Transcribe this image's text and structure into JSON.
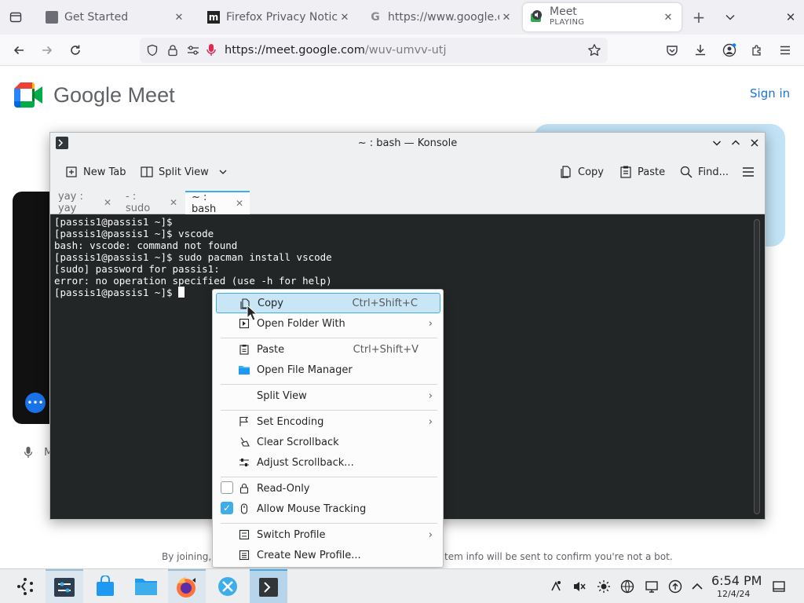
{
  "browser": {
    "tabs": [
      {
        "title": "Get Started"
      },
      {
        "title": "Firefox Privacy Notice"
      },
      {
        "title": "https://www.google.c"
      },
      {
        "title": "Meet",
        "subtitle": "PLAYING"
      }
    ],
    "url": {
      "host": "https://meet.google.com",
      "path": "/wuv-umvv-utj"
    }
  },
  "page": {
    "logo_text": "Google Meet",
    "sign_in": "Sign in",
    "mic_label": "M",
    "footer_left": "By joining, y",
    "footer_right": "tem info will be sent to confirm you're not a bot."
  },
  "konsole": {
    "title": "~ : bash — Konsole",
    "toolbar": {
      "new_tab": "New Tab",
      "split_view": "Split View",
      "copy": "Copy",
      "paste": "Paste",
      "find": "Find..."
    },
    "tabs": [
      {
        "label": "yay : yay"
      },
      {
        "label": "- : sudo"
      },
      {
        "label": "~ : bash"
      }
    ],
    "terminal_lines": [
      "[passis1@passis1 ~]$",
      "[passis1@passis1 ~]$ vscode",
      "bash: vscode: command not found",
      "[passis1@passis1 ~]$ sudo pacman install vscode",
      "[sudo] password for passis1:",
      "error: no operation specified (use -h for help)",
      "[passis1@passis1 ~]$ "
    ]
  },
  "context_menu": {
    "copy": {
      "label": "Copy",
      "shortcut": "Ctrl+Shift+C"
    },
    "open_folder_with": {
      "label": "Open Folder With"
    },
    "paste": {
      "label": "Paste",
      "shortcut": "Ctrl+Shift+V"
    },
    "open_file_manager": {
      "label": "Open File Manager"
    },
    "split_view": {
      "label": "Split View"
    },
    "set_encoding": {
      "label": "Set Encoding"
    },
    "clear_scrollback": {
      "label": "Clear Scrollback"
    },
    "adjust_scrollback": {
      "label": "Adjust Scrollback..."
    },
    "read_only": {
      "label": "Read-Only",
      "checked": false
    },
    "allow_mouse_tracking": {
      "label": "Allow Mouse Tracking",
      "checked": true
    },
    "switch_profile": {
      "label": "Switch Profile"
    },
    "create_new_profile": {
      "label": "Create New Profile..."
    }
  },
  "taskbar": {
    "time": "6:54 PM",
    "date": "12/4/24"
  },
  "icons": {
    "meet_logo_colors": [
      "#00832d",
      "#0066da",
      "#e94235",
      "#2684fc",
      "#00ac47",
      "#ffba00"
    ],
    "accent": "#3daee9"
  }
}
